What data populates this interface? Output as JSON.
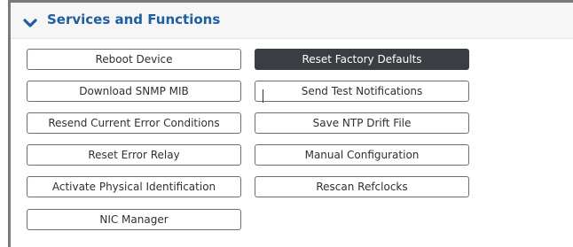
{
  "section": {
    "title": "Services and Functions",
    "icon": "chevron-down-icon",
    "accent_color": "#1f5fa0"
  },
  "buttons": {
    "reboot_device": "Reboot Device",
    "reset_factory_defaults": "Reset Factory Defaults",
    "download_snmp_mib": "Download SNMP MIB",
    "send_test_notifications": "Send Test Notifications",
    "resend_current_error_conditions": "Resend Current Error Conditions",
    "save_ntp_drift_file": "Save NTP Drift File",
    "reset_error_relay": "Reset Error Relay",
    "manual_configuration": "Manual Configuration",
    "activate_physical_identification": "Activate Physical Identification",
    "rescan_refclocks": "Rescan Refclocks",
    "nic_manager": "NIC Manager"
  },
  "colors": {
    "highlighted_button": "#3a3d42",
    "button_border": "#6e6e6e"
  }
}
